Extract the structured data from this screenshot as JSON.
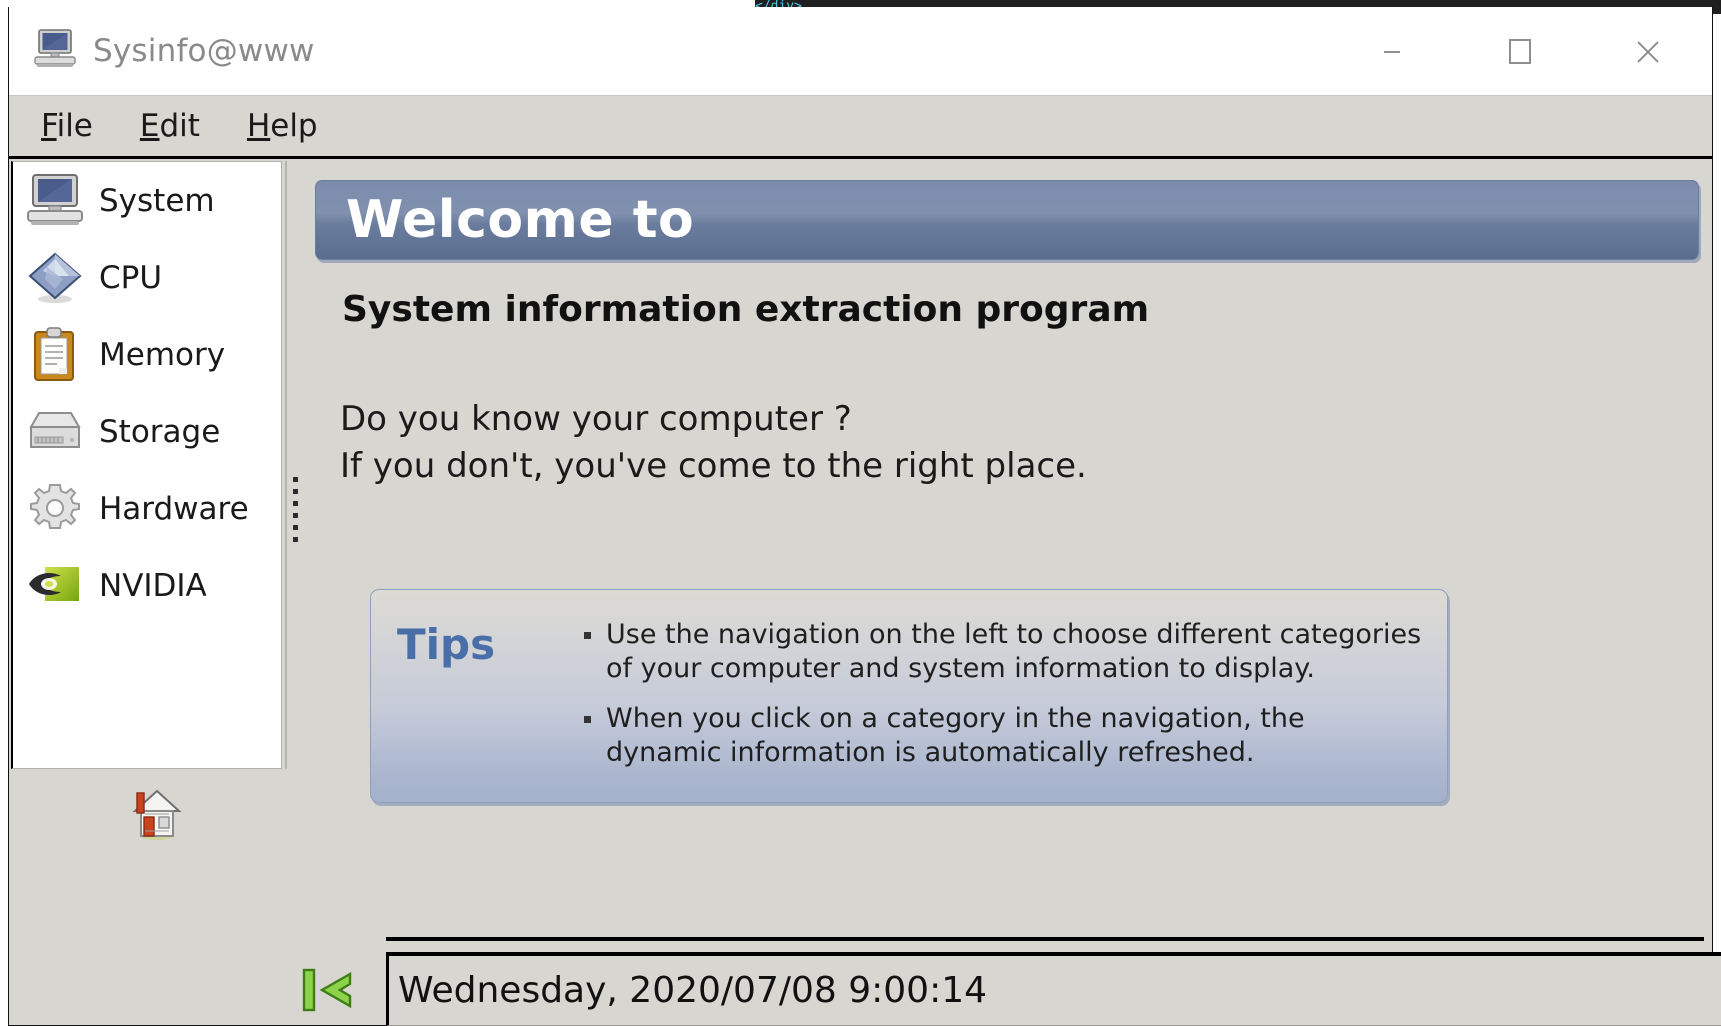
{
  "background": {
    "editor_snippet": "</div>"
  },
  "window": {
    "title": "Sysinfo@www",
    "title_icon": "computer-icon",
    "controls": {
      "minimize": "minimize-icon",
      "maximize": "maximize-icon",
      "close": "close-icon"
    }
  },
  "menubar": {
    "items": [
      {
        "mnemonic": "F",
        "rest": "ile",
        "name": "file"
      },
      {
        "mnemonic": "E",
        "rest": "dit",
        "name": "edit"
      },
      {
        "mnemonic": "H",
        "rest": "elp",
        "name": "help"
      }
    ]
  },
  "sidebar": {
    "items": [
      {
        "label": "System",
        "icon": "computer-icon"
      },
      {
        "label": "CPU",
        "icon": "cpu-diamond-icon"
      },
      {
        "label": "Memory",
        "icon": "clipboard-icon"
      },
      {
        "label": "Storage",
        "icon": "hard-drive-icon"
      },
      {
        "label": "Hardware",
        "icon": "gear-icon"
      },
      {
        "label": "NVIDIA",
        "icon": "nvidia-logo-icon"
      }
    ]
  },
  "toolbar": {
    "home_icon": "home-icon",
    "back_icon": "back-arrow-icon"
  },
  "main": {
    "banner_title": "Welcome to",
    "subtitle": "System information extraction program",
    "intro_line_1": "Do you know your computer ?",
    "intro_line_2": "If you don't, you've come to the right place.",
    "tips": {
      "label": "Tips",
      "items": [
        "Use the navigation on the left to choose different categories of your computer and system information to display.",
        "When you click on a category in the navigation, the dynamic information is automatically refreshed."
      ]
    }
  },
  "status": {
    "datetime": "Wednesday, 2020/07/08 9:00:14"
  },
  "colors": {
    "window_bg": "#d8d6d0",
    "banner_blue": "#6b7d9e",
    "tips_accent": "#4a6ea8",
    "title_text": "#8a8a8a"
  }
}
